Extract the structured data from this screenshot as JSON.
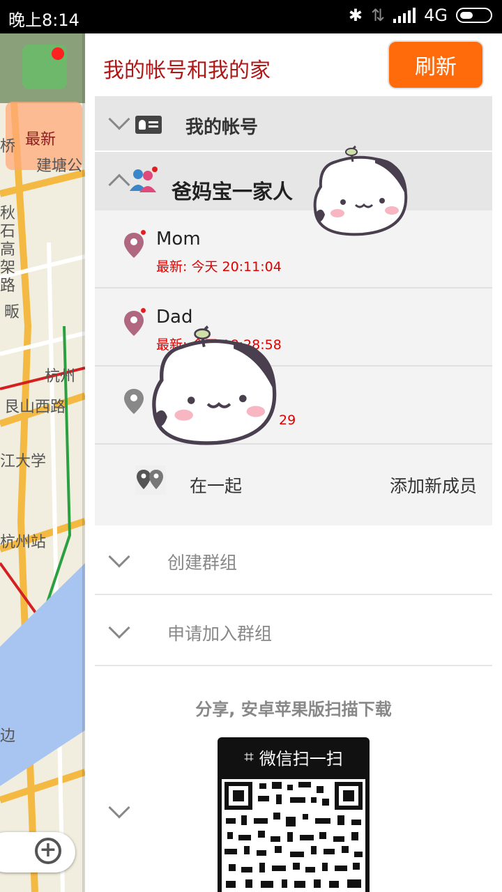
{
  "status_bar": {
    "time": "晚上8:14",
    "network": "4G"
  },
  "map": {
    "latest_label": "最新",
    "labels": [
      "桥",
      "建塘公",
      "秋",
      "石",
      "高",
      "架",
      "路",
      "畈",
      "杭州",
      "艮山西路",
      "江大学",
      "杭州站",
      "边"
    ]
  },
  "header": {
    "title": "我的帐号和我的家",
    "refresh_label": "刷新"
  },
  "account_row": {
    "label": "我的帐号"
  },
  "family": {
    "name": "爸妈宝一家人",
    "members": [
      {
        "name": "Mom",
        "last_seen": "最新: 今天 20:11:04"
      },
      {
        "name": "Dad",
        "last_seen": "最新: 今天 18:28:58"
      },
      {
        "name": "",
        "last_seen": "29"
      }
    ],
    "together_label": "在一起",
    "add_member_label": "添加新成员"
  },
  "groups": {
    "create_label": "创建群组",
    "join_label": "申请加入群组"
  },
  "share": {
    "text": "分享, 安卓苹果版扫描下载",
    "qr_caption": "微信扫一扫"
  },
  "colors": {
    "accent": "#ff6b0a",
    "title_red": "#b01818",
    "time_red": "#e00000"
  },
  "icons": {
    "bluetooth": "bluetooth-icon",
    "battery": "battery-icon",
    "family_avatar": "family-icon",
    "location_pin": "location-pin-icon",
    "scan": "scan-icon",
    "zoom": "zoom-in-icon"
  }
}
